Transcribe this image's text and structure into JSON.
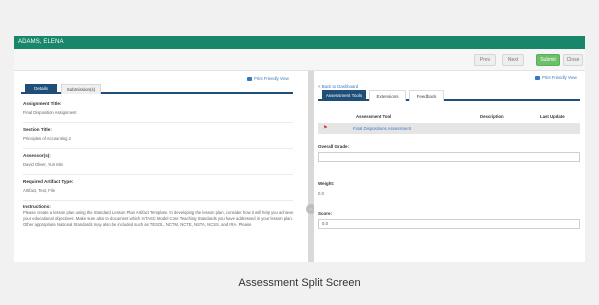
{
  "window": {
    "student_name": "ADAMS, ELENA"
  },
  "toolbar": {
    "prev": "Prev",
    "next": "Next",
    "submit": "Submit",
    "close": "Close"
  },
  "left": {
    "print_view": "Print Friendly View",
    "tabs": [
      "Details",
      "Submission(s)"
    ],
    "fields": [
      {
        "label": "Assignment Title:",
        "value": "Final Disposition Assignment"
      },
      {
        "label": "Section Title:",
        "value": "Principles of Accounting 2"
      },
      {
        "label": "Assessor(s):",
        "value": "David Oliver, Yuri Min"
      },
      {
        "label": "Required Artifact Type:",
        "value": "Artifact, Text, File"
      }
    ],
    "instructions_label": "Instructions:",
    "instructions": "Please create a lesson plan using the Standard Lesson Plan Artifact Template. In developing the lesson plan, consider how it will help you achieve your educational objectives. Make sure also to document which InTASC Model Core Teaching Standards you have addressed in your lesson plan. Other appropriate National Standards may also be included such as TESOL, NCTM, NCTE, NSTA, NCSS, and IRA. Please"
  },
  "right": {
    "back": "< Back to Dashboard",
    "print_view": "Print Friendly View",
    "tabs": [
      "Assessment Tools",
      "Extensions",
      "Feedback"
    ],
    "table_headers": [
      "Assessment Tool",
      "Description",
      "Last Update"
    ],
    "row_tool": "Final Dispositions Assessment",
    "overall_grade_label": "Overall Grade:",
    "overall_grade_value": "",
    "weight_label": "Weight:",
    "weight_value": "0.0",
    "score_label": "Score:",
    "score_value": "0.0"
  },
  "caption": "Assessment Split Screen"
}
